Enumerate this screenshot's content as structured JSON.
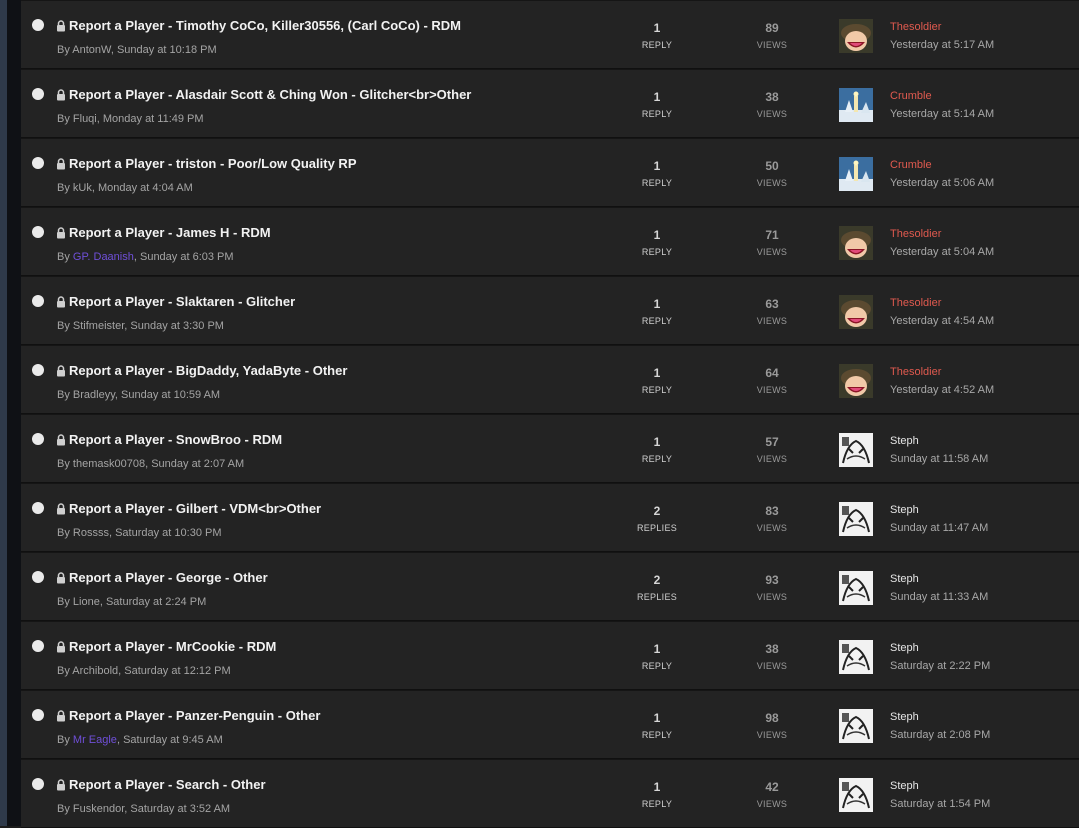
{
  "labels": {
    "reply": "REPLY",
    "replies": "REPLIES",
    "views": "VIEWS",
    "by": "By "
  },
  "colors": {
    "last_poster_highlight": "#e05a4f",
    "staff_author": "#6f4fd8"
  },
  "threads": [
    {
      "title": "Report a Player - Timothy CoCo, Killer30556, (Carl CoCo) - RDM",
      "author": "AntonW",
      "author_staff": false,
      "started": "Sunday at 10:18 PM",
      "replies": "1",
      "replies_label": "REPLY",
      "views": "89",
      "last_poster": "Thesoldier",
      "last_poster_highlight": true,
      "last_time": "Yesterday at 5:17 AM",
      "avatar": "soldier-avatar"
    },
    {
      "title": "Report a Player - Alasdair Scott & Ching Won - Glitcher<br>Other",
      "author": "Fluqi",
      "author_staff": false,
      "started": "Monday at 11:49 PM",
      "replies": "1",
      "replies_label": "REPLY",
      "views": "38",
      "last_poster": "Crumble",
      "last_poster_highlight": true,
      "last_time": "Yesterday at 5:14 AM",
      "avatar": "winter-avatar"
    },
    {
      "title": "Report a Player - triston - Poor/Low Quality RP",
      "author": "kUk",
      "author_staff": false,
      "started": "Monday at 4:04 AM",
      "replies": "1",
      "replies_label": "REPLY",
      "views": "50",
      "last_poster": "Crumble",
      "last_poster_highlight": true,
      "last_time": "Yesterday at 5:06 AM",
      "avatar": "winter-avatar"
    },
    {
      "title": "Report a Player - James H - RDM",
      "author": "GP. Daanish",
      "author_staff": true,
      "started": "Sunday at 6:03 PM",
      "replies": "1",
      "replies_label": "REPLY",
      "views": "71",
      "last_poster": "Thesoldier",
      "last_poster_highlight": true,
      "last_time": "Yesterday at 5:04 AM",
      "avatar": "soldier-avatar"
    },
    {
      "title": "Report a Player - Slaktaren - Glitcher",
      "author": "Stifmeister",
      "author_staff": false,
      "started": "Sunday at 3:30 PM",
      "replies": "1",
      "replies_label": "REPLY",
      "views": "63",
      "last_poster": "Thesoldier",
      "last_poster_highlight": true,
      "last_time": "Yesterday at 4:54 AM",
      "avatar": "soldier-avatar"
    },
    {
      "title": "Report a Player - BigDaddy, YadaByte - Other",
      "author": "Bradleyy",
      "author_staff": false,
      "started": "Sunday at 10:59 AM",
      "replies": "1",
      "replies_label": "REPLY",
      "views": "64",
      "last_poster": "Thesoldier",
      "last_poster_highlight": true,
      "last_time": "Yesterday at 4:52 AM",
      "avatar": "soldier-avatar"
    },
    {
      "title": "Report a Player - SnowBroo - RDM",
      "author": "themask00708",
      "author_staff": false,
      "started": "Sunday at 2:07 AM",
      "replies": "1",
      "replies_label": "REPLY",
      "views": "57",
      "last_poster": "Steph",
      "last_poster_highlight": false,
      "last_time": "Sunday at 11:58 AM",
      "avatar": "sketch-avatar"
    },
    {
      "title": "Report a Player - Gilbert - VDM<br>Other",
      "author": "Rossss",
      "author_staff": false,
      "started": "Saturday at 10:30 PM",
      "replies": "2",
      "replies_label": "REPLIES",
      "views": "83",
      "last_poster": "Steph",
      "last_poster_highlight": false,
      "last_time": "Sunday at 11:47 AM",
      "avatar": "sketch-avatar"
    },
    {
      "title": "Report a Player - George - Other",
      "author": "Lione",
      "author_staff": false,
      "started": "Saturday at 2:24 PM",
      "replies": "2",
      "replies_label": "REPLIES",
      "views": "93",
      "last_poster": "Steph",
      "last_poster_highlight": false,
      "last_time": "Sunday at 11:33 AM",
      "avatar": "sketch-avatar"
    },
    {
      "title": "Report a Player - MrCookie - RDM",
      "author": "Archibold",
      "author_staff": false,
      "started": "Saturday at 12:12 PM",
      "replies": "1",
      "replies_label": "REPLY",
      "views": "38",
      "last_poster": "Steph",
      "last_poster_highlight": false,
      "last_time": "Saturday at 2:22 PM",
      "avatar": "sketch-avatar"
    },
    {
      "title": "Report a Player - Panzer-Penguin - Other",
      "author": "Mr Eagle",
      "author_staff": true,
      "started": "Saturday at 9:45 AM",
      "replies": "1",
      "replies_label": "REPLY",
      "views": "98",
      "last_poster": "Steph",
      "last_poster_highlight": false,
      "last_time": "Saturday at 2:08 PM",
      "avatar": "sketch-avatar"
    },
    {
      "title": "Report a Player - Search - Other",
      "author": "Fuskendor",
      "author_staff": false,
      "started": "Saturday at 3:52 AM",
      "replies": "1",
      "replies_label": "REPLY",
      "views": "42",
      "last_poster": "Steph",
      "last_poster_highlight": false,
      "last_time": "Saturday at 1:54 PM",
      "avatar": "sketch-avatar"
    }
  ]
}
